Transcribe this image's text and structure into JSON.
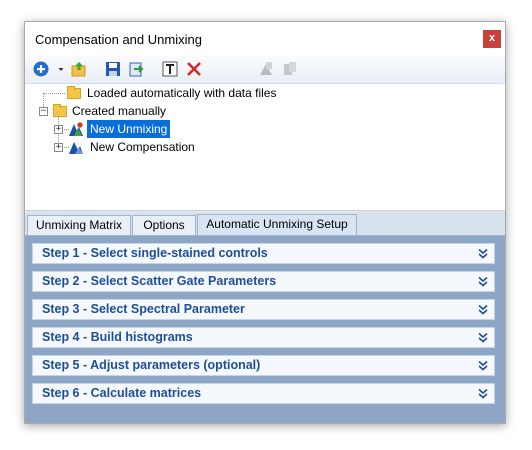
{
  "window": {
    "title": "Compensation and Unmixing",
    "close_label": "x"
  },
  "toolbar": {
    "icons": [
      "add-icon",
      "dropdown-arrow-icon",
      "open-folder-icon",
      "save-icon",
      "export-icon",
      "text-icon",
      "delete-icon",
      "copy-disabled-icon",
      "paste-disabled-icon"
    ]
  },
  "tree": {
    "items": [
      {
        "label": "Loaded automatically with data files",
        "type": "folder"
      },
      {
        "label": "Created manually",
        "type": "folder",
        "expanded": true
      },
      {
        "label": "New Unmixing",
        "type": "unmixing",
        "selected": true
      },
      {
        "label": "New Compensation",
        "type": "compensation"
      }
    ]
  },
  "tabs": [
    {
      "label": "Unmixing Matrix",
      "active": false
    },
    {
      "label": "Options",
      "active": false
    },
    {
      "label": "Automatic Unmixing Setup",
      "active": true
    }
  ],
  "steps": [
    {
      "label": "Step 1 - Select single-stained controls"
    },
    {
      "label": "Step 2 - Select Scatter Gate Parameters"
    },
    {
      "label": "Step 3 - Select Spectral Parameter"
    },
    {
      "label": "Step 4 - Build histograms"
    },
    {
      "label": "Step 5 - Adjust parameters (optional)"
    },
    {
      "label": "Step 6 - Calculate matrices"
    }
  ],
  "colors": {
    "accent": "#0a6ed9",
    "step_text": "#1e4e9a",
    "panel_bg": "#8da6c6",
    "close_bg": "#c9413a"
  }
}
